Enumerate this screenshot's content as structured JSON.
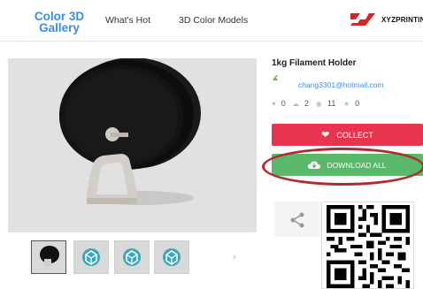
{
  "header": {
    "logo_line1": "Color 3D",
    "logo_line2": "Gallery",
    "nav": [
      "What's Hot",
      "3D Color Models"
    ],
    "brand_text": "XYZPRINTIN",
    "brand_logo_icon": "xyz-logo-icon"
  },
  "model": {
    "title": "1kg Filament Holder",
    "author_email": "chang3301@hotmail.com",
    "stats": {
      "likes": "0",
      "downloads": "2",
      "views": "11",
      "rating": "0"
    },
    "collect_label": "COLLECT",
    "download_label": "DOWNLOAD ALL"
  },
  "thumbnails": {
    "count": 4,
    "next_symbol": "›"
  },
  "colors": {
    "accent_blue": "#3b8ee3",
    "collect_red": "#e8344f",
    "download_green": "#5ab86a",
    "highlight_ring": "#b22a2f"
  },
  "icons": {
    "heart": "heart-icon",
    "download": "cloud-download-icon",
    "share": "share-icon",
    "qr": "qr-code-icon"
  }
}
